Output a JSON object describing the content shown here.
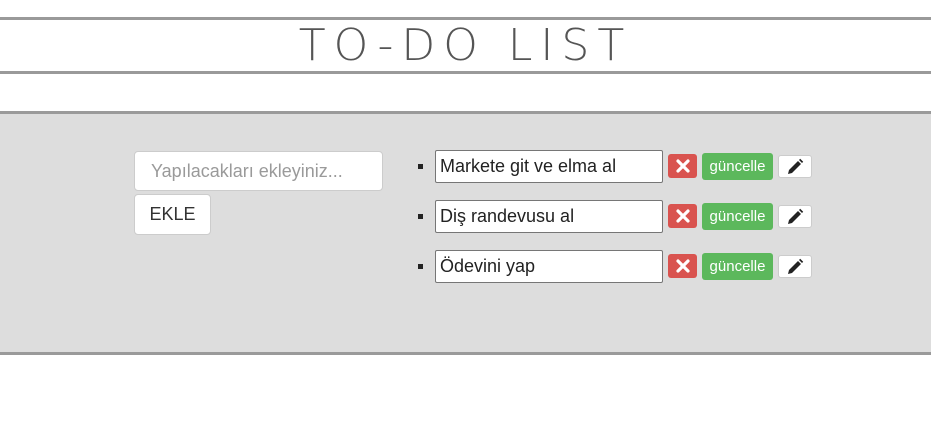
{
  "header": {
    "title": "TO-DO LIST"
  },
  "form": {
    "placeholder": "Yapılacakları ekleyiniz...",
    "value": "",
    "add_label": "EKLE"
  },
  "todos": [
    {
      "text": "Markete git ve elma al",
      "update_label": "güncelle",
      "delete_icon": "x-icon",
      "edit_icon": "pencil-icon"
    },
    {
      "text": "Diş randevusu al",
      "update_label": "güncelle",
      "delete_icon": "x-icon",
      "edit_icon": "pencil-icon"
    },
    {
      "text": "Ödevini yap",
      "update_label": "güncelle",
      "delete_icon": "x-icon",
      "edit_icon": "pencil-icon"
    }
  ],
  "colors": {
    "panel_bg": "#dddddd",
    "border": "#9a9a9a",
    "delete": "#d9534f",
    "update": "#5cb85c",
    "title": "#555555"
  }
}
